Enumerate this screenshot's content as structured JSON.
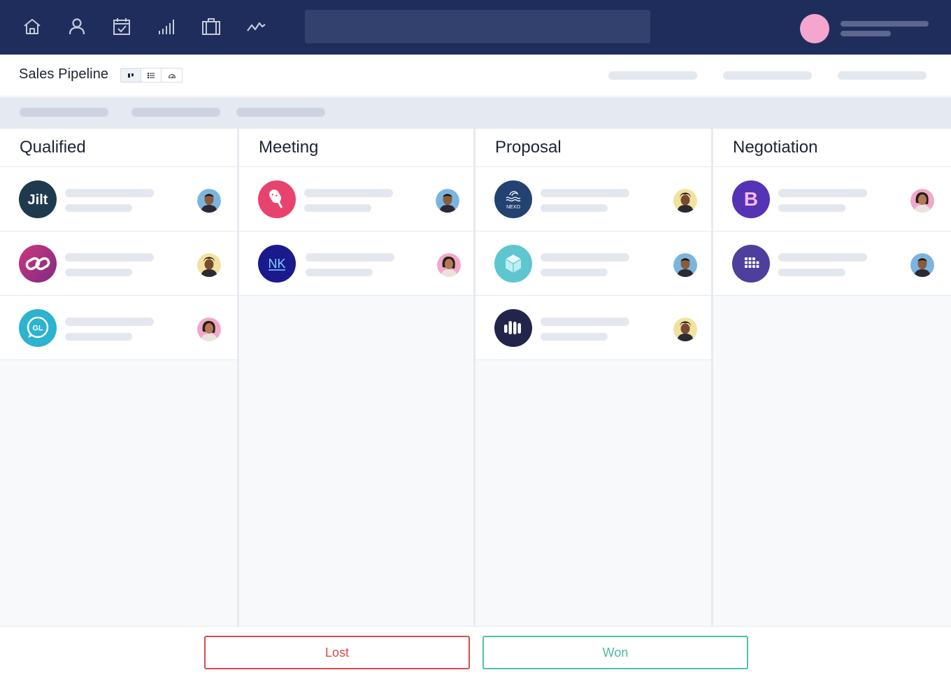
{
  "nav": {
    "icons": [
      "home-icon",
      "person-icon",
      "calendar-check-icon",
      "signal-bars-icon",
      "briefcase-icon",
      "activity-icon"
    ],
    "icon_color": "#c5cbdc",
    "background": "#1f2d5c"
  },
  "header": {
    "title": "Sales Pipeline",
    "views": [
      "board-view-icon",
      "list-view-icon",
      "gauge-view-icon"
    ]
  },
  "columns": [
    {
      "title": "Qualified",
      "cards": [
        {
          "logo_text": "Jilt",
          "logo_color": "#1f3a4d",
          "logo_icon": "jilt-logo-icon",
          "owner": "man-avatar-blue"
        },
        {
          "logo_text": "",
          "logo_color": "#a0307a",
          "logo_icon": "infinity-logo-icon",
          "owner": "man-avatar-yellow"
        },
        {
          "logo_text": "GL",
          "logo_color": "#2bb3cf",
          "logo_icon": "chat-bubble-logo-icon",
          "owner": "woman-avatar-pink"
        }
      ]
    },
    {
      "title": "Meeting",
      "cards": [
        {
          "logo_text": "",
          "logo_color": "#e8436e",
          "logo_icon": "popsicle-logo-icon",
          "owner": "man-avatar-blue"
        },
        {
          "logo_text": "NK",
          "logo_color": "#1a1a8c",
          "logo_icon": "nk-logo-icon",
          "owner": "woman-avatar-pink"
        }
      ]
    },
    {
      "title": "Proposal",
      "cards": [
        {
          "logo_text": "NEXO",
          "logo_color": "#234272",
          "logo_icon": "wave-logo-icon",
          "owner": "man-avatar-yellow"
        },
        {
          "logo_text": "",
          "logo_color": "#5ec6cf",
          "logo_icon": "cube-logo-icon",
          "owner": "man-avatar-blue"
        },
        {
          "logo_text": "",
          "logo_color": "#22244a",
          "logo_icon": "bars-logo-icon",
          "owner": "man-avatar-yellow"
        }
      ]
    },
    {
      "title": "Negotiation",
      "cards": [
        {
          "logo_text": "B",
          "logo_color": "#5433b5",
          "logo_icon": "b-logo-icon",
          "owner": "woman-avatar-pink"
        },
        {
          "logo_text": "",
          "logo_color": "#4f3f9c",
          "logo_icon": "grid-logo-icon",
          "owner": "man-avatar-blue"
        }
      ]
    }
  ],
  "footer": {
    "lost_label": "Lost",
    "won_label": "Won",
    "lost_color": "#e04848",
    "won_color": "#4fc0a6"
  }
}
